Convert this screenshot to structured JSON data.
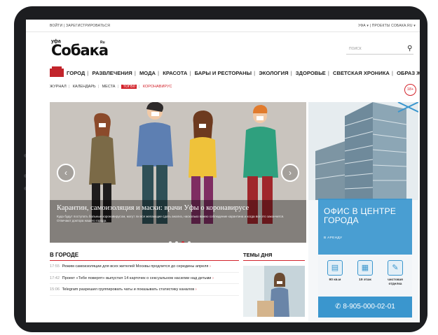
{
  "topbar": {
    "left": "ВОЙТИ | ЗАРЕГИСТРИРОВАТЬСЯ",
    "right": "УФА ▾ | ПРОЕКТЫ СОБАКА.RU ▾"
  },
  "logo": {
    "city": "уфа",
    "name": "Собака",
    "suffix": "Ru"
  },
  "search": {
    "placeholder": "ПОИСК"
  },
  "nav": {
    "items": [
      "ГОРОД",
      "РАЗВЛЕЧЕНИЯ",
      "МОДА",
      "КРАСОТА",
      "БАРЫ И РЕСТОРАНЫ",
      "ЭКОЛОГИЯ",
      "ЗДОРОВЬЕ",
      "СВЕТСКАЯ ХРОНИКА",
      "ОБРАЗ ЖИЗНИ"
    ]
  },
  "subnav": {
    "items": [
      "ЖУРНАЛ",
      "КАЛЕНДАРЬ",
      "МЕСТА"
    ],
    "tag": "ТОП50",
    "special": "КОРОНАВИРУС"
  },
  "age_badge": "18+",
  "hero": {
    "caption": "Карантин, самоизоляция и маски: врачи Уфы о коронавирусе",
    "description": "Куда будут поступать больные коронавирусом, могут ли все желающие сдать анализ, насколько важно соблюдение карантина и когда все это закончится. Отвечают доктора нашего города."
  },
  "ad": {
    "title": "ОФИС В ЦЕНТРЕ ГОРОДА",
    "subtitle": "В АРЕНДУ",
    "features": [
      "90 кв.м",
      "19 этаж",
      "чистовая отделка"
    ],
    "phone": "8-905-000-02-01"
  },
  "news": {
    "heading": "В ГОРОДЕ",
    "items": [
      {
        "time": "17:55",
        "text": "Режим самоизоляции для всех жителей Москвы продлится до середины апреля"
      },
      {
        "time": "17:42",
        "text": "Проект «Тебе поверят» выпустил 14 карточек о сексуальном насилии над детьми"
      },
      {
        "time": "15:06",
        "text": "Telegram разрешил группировать чаты и показывать статистику каналов"
      }
    ]
  },
  "themes": {
    "heading": "ТЕМЫ ДНЯ"
  },
  "colors": {
    "accent": "#d3232b",
    "ad_blue": "#3a96ce"
  }
}
